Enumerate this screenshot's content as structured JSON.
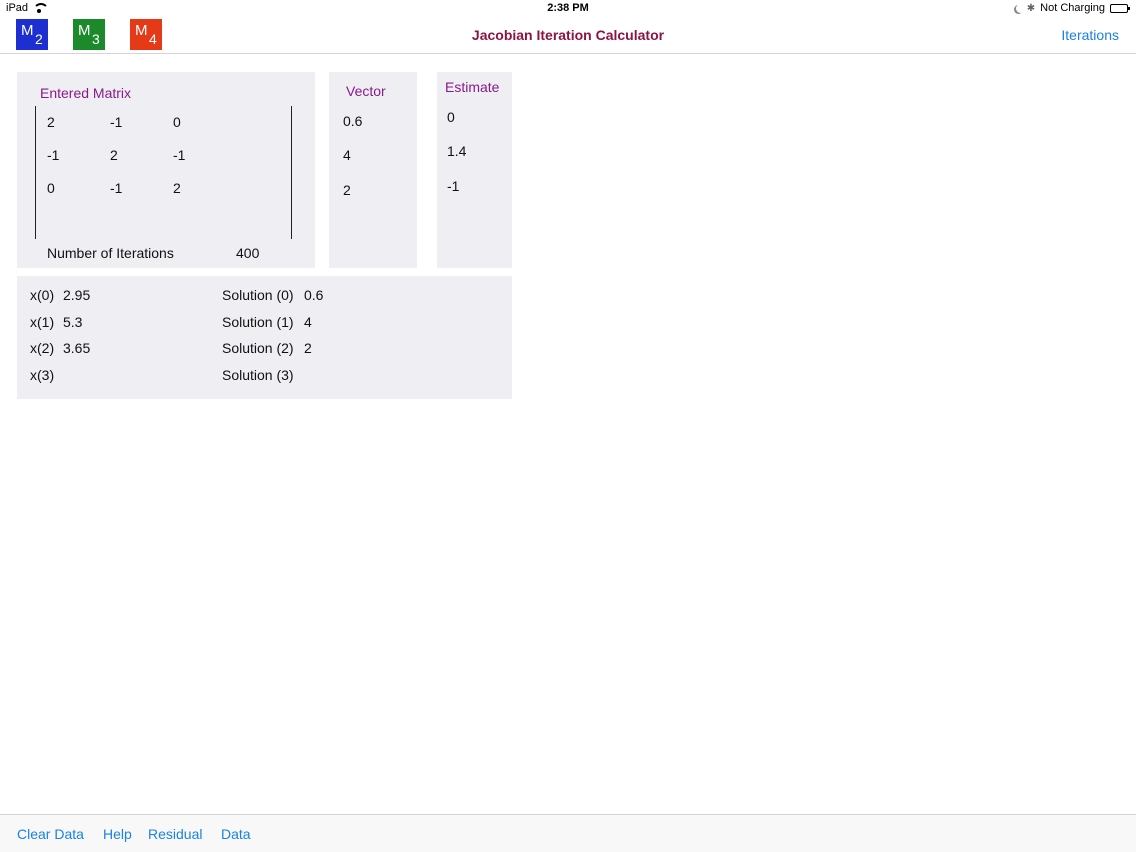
{
  "status_bar": {
    "device": "iPad",
    "time": "2:38 PM",
    "charging": "Not Charging"
  },
  "nav": {
    "title": "Jacobian Iteration Calculator",
    "right_button": "Iterations",
    "matrix_buttons": [
      {
        "letter": "M",
        "sub": "2",
        "color": "#1e2fd2"
      },
      {
        "letter": "M",
        "sub": "3",
        "color": "#1c8a2a"
      },
      {
        "letter": "M",
        "sub": "4",
        "color": "#e43a18"
      }
    ]
  },
  "matrix_panel": {
    "title": "Entered Matrix",
    "rows": [
      [
        "2",
        "-1",
        "0"
      ],
      [
        "-1",
        "2",
        "-1"
      ],
      [
        "0",
        "-1",
        "2"
      ]
    ],
    "iterations_label": "Number of Iterations",
    "iterations_value": "400"
  },
  "vector_panel": {
    "title": "Vector",
    "values": [
      "0.6",
      "4",
      "2"
    ]
  },
  "estimate_panel": {
    "title": "Estimate",
    "values": [
      "0",
      "1.4",
      "-1"
    ]
  },
  "results": {
    "x": [
      {
        "label": "x(0)",
        "value": "2.95"
      },
      {
        "label": "x(1)",
        "value": "5.3"
      },
      {
        "label": "x(2)",
        "value": "3.65"
      },
      {
        "label": "x(3)",
        "value": ""
      }
    ],
    "solutions": [
      {
        "label": "Solution (0)",
        "value": "0.6"
      },
      {
        "label": "Solution (1)",
        "value": "4"
      },
      {
        "label": "Solution (2)",
        "value": "2"
      },
      {
        "label": "Solution (3)",
        "value": ""
      }
    ]
  },
  "toolbar": {
    "items": [
      "Clear Data",
      "Help",
      "Residual",
      "Data"
    ]
  },
  "colors": {
    "accent": "#1a82e2",
    "title": "#8b1444",
    "panel_title": "#8a1a8a",
    "panel_bg": "#efeff3"
  }
}
